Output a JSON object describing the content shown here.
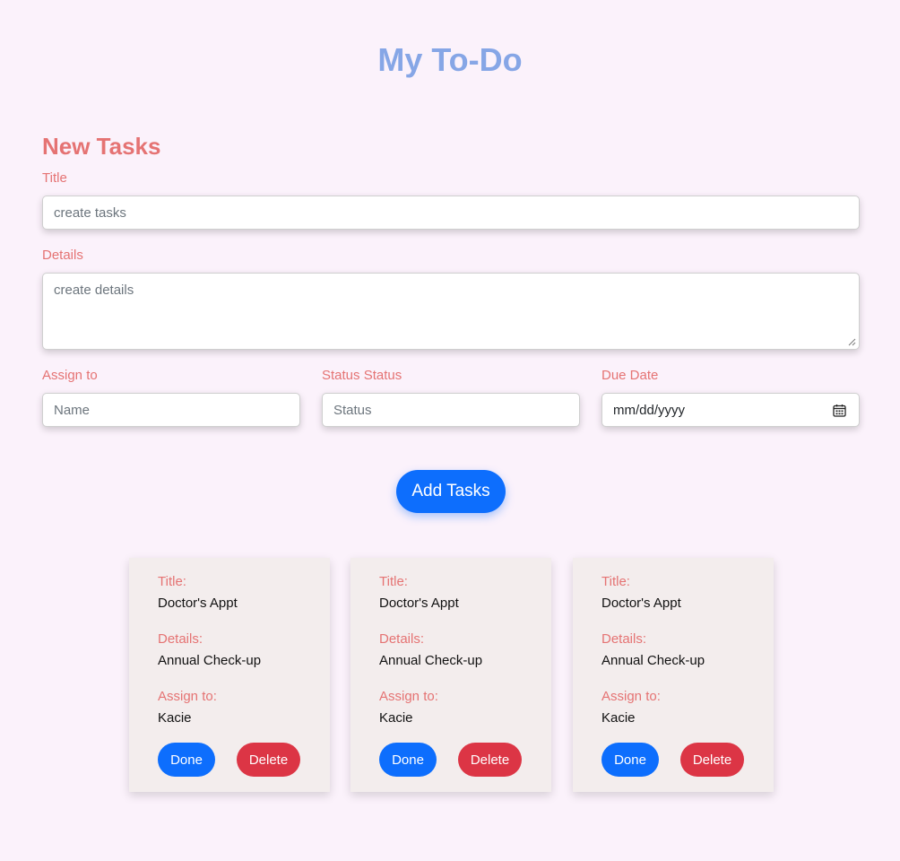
{
  "app": {
    "title": "My To-Do"
  },
  "form": {
    "heading": "New Tasks",
    "title_label": "Title",
    "title_placeholder": "create tasks",
    "details_label": "Details",
    "details_placeholder": "create details",
    "assign_label": "Assign to",
    "assign_placeholder": "Name",
    "status_label": "Status Status",
    "status_placeholder": "Status",
    "due_label": "Due Date",
    "due_placeholder": "mm/dd/yyyy",
    "add_button": "Add Tasks"
  },
  "cards": [
    {
      "title_key": "Title:",
      "title": "Doctor's Appt",
      "details_key": "Details:",
      "details": "Annual Check-up",
      "assign_key": "Assign to:",
      "assign": "Kacie",
      "done": "Done",
      "delete": "Delete"
    },
    {
      "title_key": "Title:",
      "title": "Doctor's Appt",
      "details_key": "Details:",
      "details": "Annual Check-up",
      "assign_key": "Assign to:",
      "assign": "Kacie",
      "done": "Done",
      "delete": "Delete"
    },
    {
      "title_key": "Title:",
      "title": "Doctor's Appt",
      "details_key": "Details:",
      "details": "Annual Check-up",
      "assign_key": "Assign to:",
      "assign": "Kacie",
      "done": "Done",
      "delete": "Delete"
    }
  ],
  "colors": {
    "background": "#fbf2fb",
    "app_title": "#86a6e6",
    "label": "#e57373",
    "primary": "#0d6efd",
    "danger": "#dc3545",
    "card": "#f3eded"
  }
}
